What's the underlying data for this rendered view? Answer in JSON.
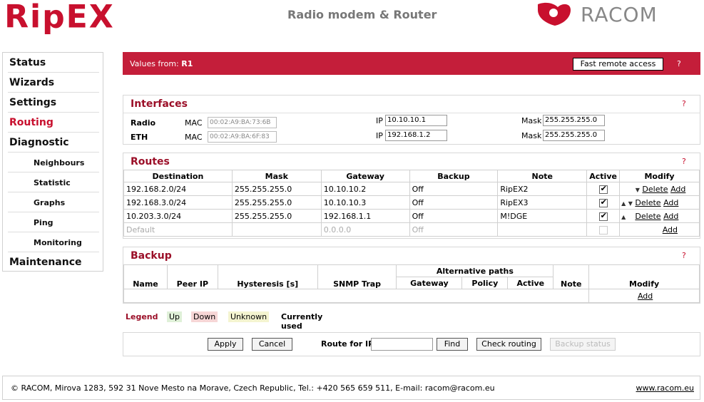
{
  "header": {
    "logo_left": "RipEX",
    "subtitle": "Radio modem & Router",
    "logo_right": "RACOM"
  },
  "sidebar": {
    "items": [
      {
        "label": "Status"
      },
      {
        "label": "Wizards"
      },
      {
        "label": "Settings"
      },
      {
        "label": "Routing",
        "active": true
      },
      {
        "label": "Diagnostic"
      },
      {
        "label": "Neighbours",
        "sub": true
      },
      {
        "label": "Statistic",
        "sub": true
      },
      {
        "label": "Graphs",
        "sub": true
      },
      {
        "label": "Ping",
        "sub": true
      },
      {
        "label": "Monitoring",
        "sub": true
      },
      {
        "label": "Maintenance"
      }
    ]
  },
  "values_bar": {
    "prefix": "Values from:",
    "station": "R1",
    "fast_remote_access": "Fast remote access",
    "help": "?"
  },
  "interfaces": {
    "title": "Interfaces",
    "help": "?",
    "rows": [
      {
        "name": "Radio",
        "mac_label": "MAC",
        "mac": "00:02:A9:BA:73:6B",
        "ip_label": "IP",
        "ip": "10.10.10.1",
        "mask_label": "Mask",
        "mask": "255.255.255.0"
      },
      {
        "name": "ETH",
        "mac_label": "MAC",
        "mac": "00:02:A9:BA:6F:83",
        "ip_label": "IP",
        "ip": "192.168.1.2",
        "mask_label": "Mask",
        "mask": "255.255.255.0"
      }
    ]
  },
  "routes": {
    "title": "Routes",
    "help": "?",
    "columns": [
      "Destination",
      "Mask",
      "Gateway",
      "Backup",
      "Note",
      "Active",
      "Modify"
    ],
    "rows": [
      {
        "destination": "192.168.2.0/24",
        "mask": "255.255.255.0",
        "gateway": "10.10.10.2",
        "backup": "Off",
        "note": "RipEX2",
        "active": true,
        "up": false,
        "down": true
      },
      {
        "destination": "192.168.3.0/24",
        "mask": "255.255.255.0",
        "gateway": "10.10.10.3",
        "backup": "Off",
        "note": "RipEX3",
        "active": true,
        "up": true,
        "down": true
      },
      {
        "destination": "10.203.3.0/24",
        "mask": "255.255.255.0",
        "gateway": "192.168.1.1",
        "backup": "Off",
        "note": "M!DGE",
        "active": true,
        "up": true,
        "down": false
      }
    ],
    "default_row": {
      "destination": "Default",
      "mask": "",
      "gateway": "0.0.0.0",
      "backup": "Off",
      "note": ""
    },
    "delete_label": "Delete",
    "add_label": "Add"
  },
  "backup": {
    "title": "Backup",
    "help": "?",
    "columns": [
      "Name",
      "Peer IP",
      "Hysteresis [s]",
      "SNMP Trap",
      "Note",
      "Modify"
    ],
    "alt_paths_label": "Alternative paths",
    "alt_columns": [
      "Gateway",
      "Policy",
      "Active"
    ],
    "add_label": "Add"
  },
  "legend": {
    "label": "Legend",
    "up": "Up",
    "down": "Down",
    "unknown": "Unknown",
    "current": "Currently used",
    "colors": {
      "up": "#dff0d8",
      "down": "#f6d6d6",
      "unknown": "#f4f4d0"
    }
  },
  "actions": {
    "apply": "Apply",
    "cancel": "Cancel",
    "route_for_ip": "Route for IP:",
    "route_ip_value": "",
    "find": "Find",
    "check_routing": "Check routing",
    "backup_status": "Backup status"
  },
  "footer": {
    "text": "© RACOM, Mirova 1283, 592 31 Nove Mesto na Morave, Czech Republic, Tel.: +420 565 659 511, E-mail: racom@racom.eu",
    "link": "www.racom.eu"
  },
  "colors": {
    "accent": "#c41e3a",
    "title": "#9b0f28"
  }
}
